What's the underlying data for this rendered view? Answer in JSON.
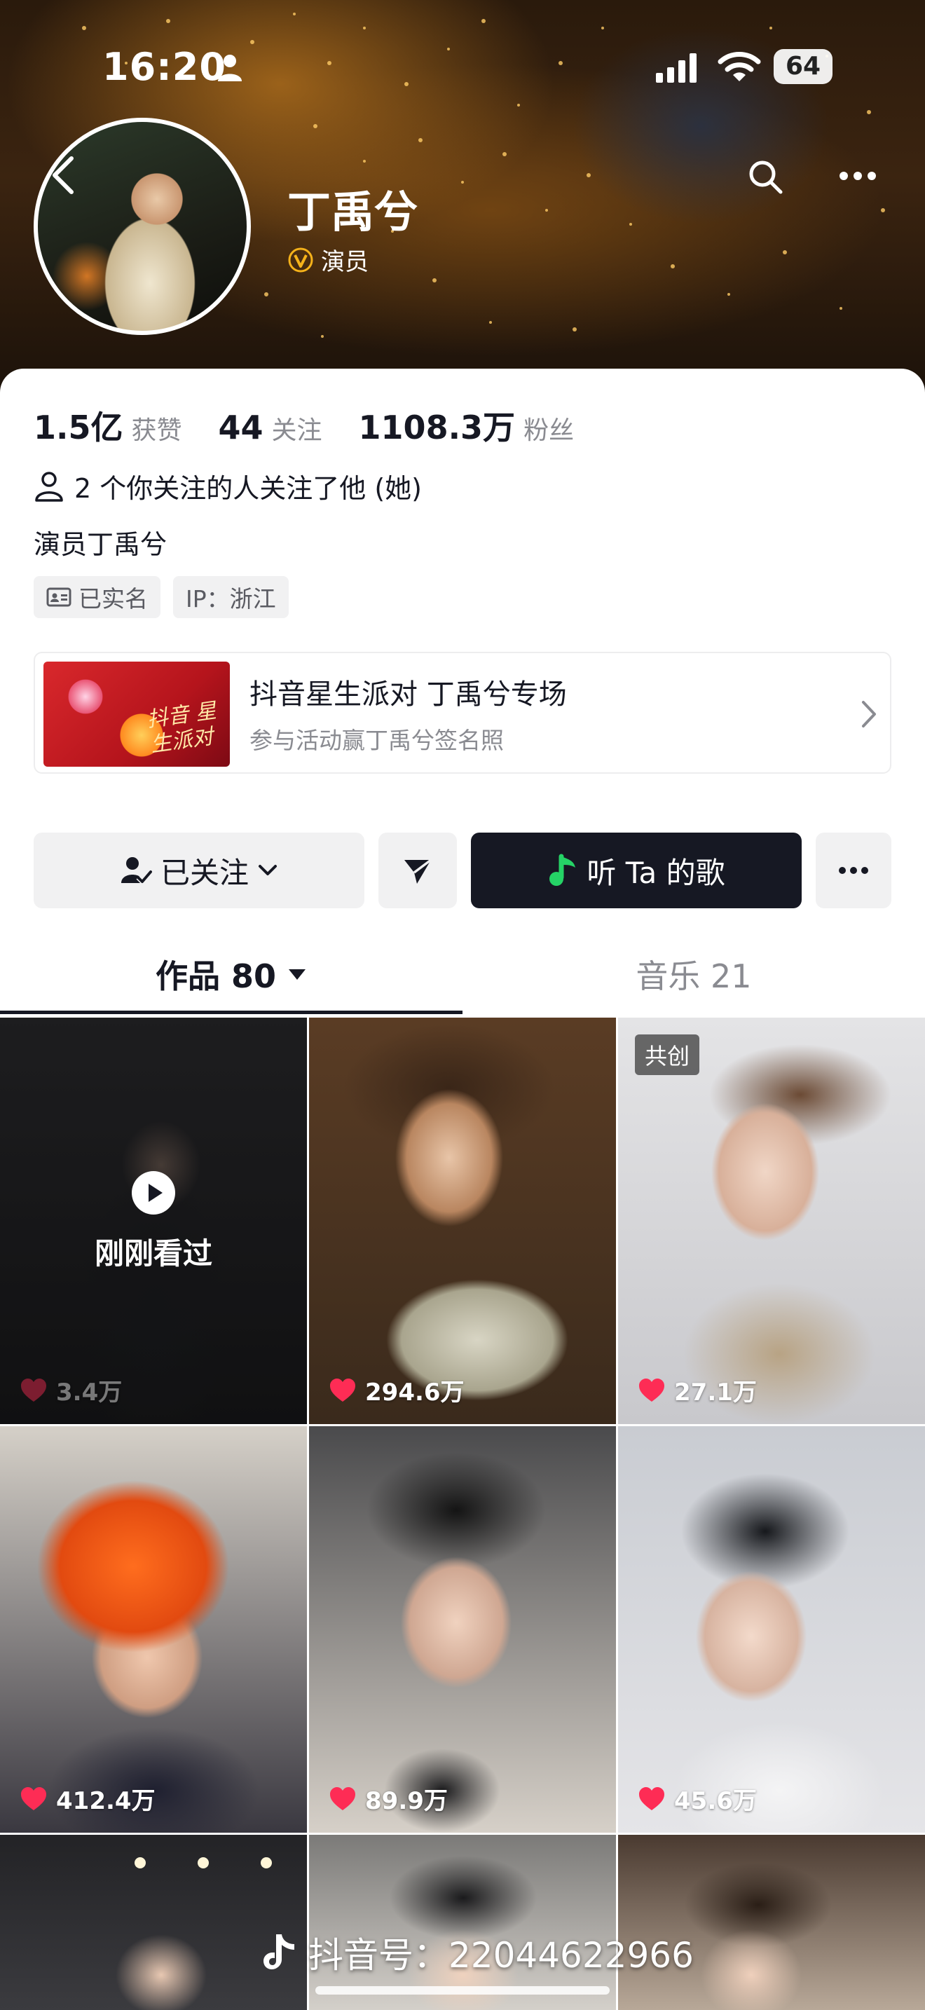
{
  "status_bar": {
    "time": "16:20",
    "battery": "64"
  },
  "profile": {
    "name": "丁禹兮",
    "verified_label": "演员",
    "stats": [
      {
        "value": "1.5亿",
        "label": "获赞"
      },
      {
        "value": "44",
        "label": "关注"
      },
      {
        "value": "1108.3万",
        "label": "粉丝"
      }
    ],
    "mutual_followers": "2 个你关注的人关注了他 (她)",
    "bio": "演员丁禹兮",
    "tags": [
      "已实名",
      "IP：浙江"
    ]
  },
  "promo": {
    "title": "抖音星生派对 丁禹兮专场",
    "subtitle": "参与活动赢丁禹兮签名照",
    "thumb_text": "抖音 星生派对"
  },
  "actions": {
    "follow_label": "已关注",
    "music_label": "听 Ta 的歌"
  },
  "tabs": [
    {
      "label": "作品 80",
      "active": true
    },
    {
      "label": "音乐 21",
      "active": false
    }
  ],
  "videos": [
    {
      "likes": "3.4万",
      "overlay": "刚刚看过"
    },
    {
      "likes": "294.6万"
    },
    {
      "likes": "27.1万",
      "badge": "共创"
    },
    {
      "likes": "412.4万"
    },
    {
      "likes": "89.9万"
    },
    {
      "likes": "45.6万"
    }
  ],
  "watermark": "抖音号：22044622966",
  "colors": {
    "accent_dark": "#161823",
    "muted_text": "#8a8b91",
    "heart": "#fe2c55",
    "verify_gold": "#f5b21a",
    "music_green": "#25d366"
  }
}
